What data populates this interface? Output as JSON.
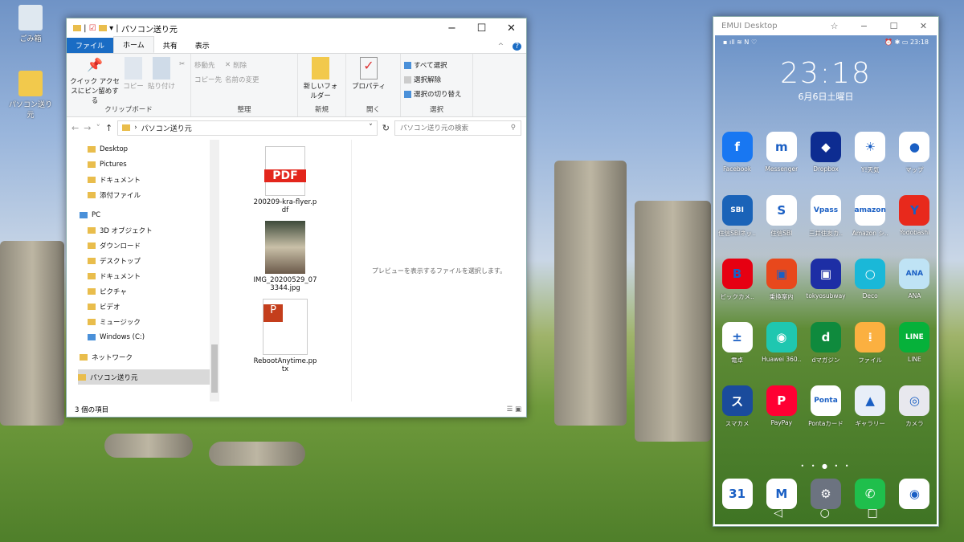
{
  "desktop": {
    "icons": [
      {
        "label": "ごみ箱"
      },
      {
        "label": "パソコン送り元"
      }
    ]
  },
  "explorer": {
    "title": "パソコン送り元",
    "tabs": [
      "ファイル",
      "ホーム",
      "共有",
      "表示"
    ],
    "ribbon": {
      "clipboard": {
        "pin": "クイック アクセスにピン留めする",
        "copy": "コピー",
        "paste": "貼り付け",
        "label": "クリップボード"
      },
      "organize": {
        "move": "移動先",
        "delete": "削除",
        "copyto": "コピー先",
        "rename": "名前の変更",
        "label": "整理"
      },
      "new": {
        "folder": "新しいフォルダー",
        "label": "新規"
      },
      "open": {
        "props": "プロパティ",
        "label": "開く"
      },
      "select": {
        "all": "すべて選択",
        "none": "選択解除",
        "invert": "選択の切り替え",
        "label": "選択"
      }
    },
    "address": "パソコン送り元",
    "search_placeholder": "パソコン送り元の検索",
    "nav": [
      "Desktop",
      "Pictures",
      "ドキュメント",
      "添付ファイル",
      "PC",
      "3D オブジェクト",
      "ダウンロード",
      "デスクトップ",
      "ドキュメント",
      "ピクチャ",
      "ビデオ",
      "ミュージック",
      "Windows (C:)",
      "ネットワーク",
      "パソコン送り元"
    ],
    "files": [
      {
        "name": "200209-kra-flyer.pdf",
        "badge": "PDF"
      },
      {
        "name": "IMG_20200529_073344.jpg"
      },
      {
        "name": "RebootAnytime.pptx"
      }
    ],
    "preview_text": "プレビューを表示するファイルを選択します。",
    "status": "3 個の項目"
  },
  "phone": {
    "title": "EMUI Desktop",
    "status_time": "23:18",
    "clock": "23:18",
    "date": "6月6日土曜日",
    "apps": [
      {
        "label": "Facebook",
        "glyph": "f",
        "color": "#1877f2"
      },
      {
        "label": "Messenger",
        "glyph": "m",
        "color": "#ffffff"
      },
      {
        "label": "Dropbox",
        "glyph": "◆",
        "color": "#0d2c91"
      },
      {
        "label": "Y!天気",
        "glyph": "☀",
        "color": "#ffffff"
      },
      {
        "label": "マップ",
        "glyph": "●",
        "color": "#ffffff"
      },
      {
        "label": "住信SBIネッ..",
        "glyph": "SBI",
        "color": "#1a63b8"
      },
      {
        "label": "住信SBI",
        "glyph": "S",
        "color": "#ffffff"
      },
      {
        "label": "三井住友カ..",
        "glyph": "Vpass",
        "color": "#ffffff"
      },
      {
        "label": "Amazon シ..",
        "glyph": "amazon",
        "color": "#ffffff"
      },
      {
        "label": "Yodobashi",
        "glyph": "Y",
        "color": "#e8291c"
      },
      {
        "label": "ビックカメ..",
        "glyph": "B",
        "color": "#e60012"
      },
      {
        "label": "乗換案内",
        "glyph": "▣",
        "color": "#e8481c"
      },
      {
        "label": "tokyosubway",
        "glyph": "▣",
        "color": "#1d2ea5"
      },
      {
        "label": "Deco",
        "glyph": "○",
        "color": "#1ab8d8"
      },
      {
        "label": "ANA",
        "glyph": "ANA",
        "color": "#bfe3f5"
      },
      {
        "label": "電卓",
        "glyph": "±",
        "color": "#ffffff"
      },
      {
        "label": "Huawei 360..",
        "glyph": "◉",
        "color": "#1fc7b0"
      },
      {
        "label": "dマガジン",
        "glyph": "d",
        "color": "#0f8a3d"
      },
      {
        "label": "ファイル",
        "glyph": "⁞",
        "color": "#fbb040"
      },
      {
        "label": "LINE",
        "glyph": "LINE",
        "color": "#06b13a"
      },
      {
        "label": "スマカメ",
        "glyph": "ス",
        "color": "#1a4b9c"
      },
      {
        "label": "PayPay",
        "glyph": "P",
        "color": "#ff0033"
      },
      {
        "label": "Pontaカード",
        "glyph": "Ponta",
        "color": "#ffffff"
      },
      {
        "label": "ギャラリー",
        "glyph": "▲",
        "color": "#e8eef8"
      },
      {
        "label": "カメラ",
        "glyph": "◎",
        "color": "#e8e8ee"
      }
    ],
    "dock": [
      {
        "label": "calendar",
        "glyph": "31",
        "color": "#ffffff"
      },
      {
        "label": "gmail",
        "glyph": "M",
        "color": "#ffffff"
      },
      {
        "label": "settings",
        "glyph": "⚙",
        "color": "#6c7380"
      },
      {
        "label": "phone",
        "glyph": "✆",
        "color": "#1fbf4c"
      },
      {
        "label": "chrome",
        "glyph": "◉",
        "color": "#ffffff"
      }
    ]
  }
}
